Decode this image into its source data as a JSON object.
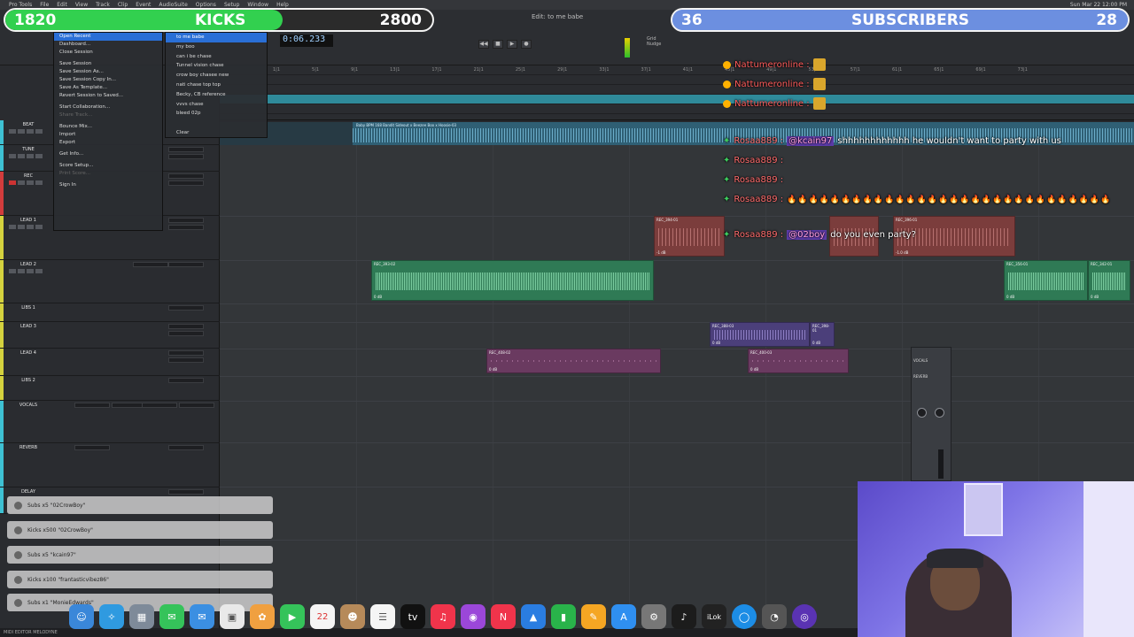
{
  "menubar": {
    "items": [
      "Pro Tools",
      "File",
      "Edit",
      "View",
      "Track",
      "Clip",
      "Event",
      "AudioSuite",
      "Options",
      "Setup",
      "Window",
      "Help"
    ],
    "clock": "Sun Mar 22  12:00 PM"
  },
  "session": {
    "edit_title": "Edit: to me babe",
    "counter": "0:06.233"
  },
  "overlays": {
    "kicks": {
      "current": "1820",
      "label": "KICKS",
      "goal": "2800",
      "progress": 0.65,
      "color": "#32d04f"
    },
    "subscribers": {
      "current": "36",
      "label": "SUBSCRIBERS",
      "goal": "28",
      "progress": 1.0,
      "color": "#6c8fe0"
    }
  },
  "file_menu": {
    "items": [
      {
        "label": "Open Recent",
        "state": "highlight"
      },
      {
        "label": "Dashboard...",
        "state": "normal"
      },
      {
        "label": "Close Session",
        "state": "normal"
      },
      {
        "label": "",
        "state": "sep"
      },
      {
        "label": "Save Session",
        "state": "normal"
      },
      {
        "label": "Save Session As...",
        "state": "normal"
      },
      {
        "label": "Save Session Copy In...",
        "state": "normal"
      },
      {
        "label": "Save As Template...",
        "state": "normal"
      },
      {
        "label": "Revert Session to Saved...",
        "state": "normal"
      },
      {
        "label": "",
        "state": "sep"
      },
      {
        "label": "Start Collaboration...",
        "state": "normal"
      },
      {
        "label": "Share Track...",
        "state": "dim"
      },
      {
        "label": "",
        "state": "sep"
      },
      {
        "label": "Bounce Mix...",
        "state": "normal"
      },
      {
        "label": "Import",
        "state": "normal"
      },
      {
        "label": "Export",
        "state": "normal"
      },
      {
        "label": "",
        "state": "sep"
      },
      {
        "label": "Get Info...",
        "state": "normal"
      },
      {
        "label": "",
        "state": "sep"
      },
      {
        "label": "Score Setup...",
        "state": "normal"
      },
      {
        "label": "Print Score...",
        "state": "dim"
      },
      {
        "label": "",
        "state": "sep"
      },
      {
        "label": "Sign In",
        "state": "normal"
      }
    ]
  },
  "recent_menu": {
    "items": [
      "to me babe",
      "my boo",
      "can i be chase",
      "Tunnel vision chase",
      "crow boy chasee new",
      "nati chase top top",
      "Becky, CB reference",
      "vvvs chase",
      "bleed 02p",
      "",
      "Clear"
    ]
  },
  "tracks": [
    {
      "name": "BEAT",
      "color": "#3ec1d3"
    },
    {
      "name": "TUNE",
      "color": "#3ec1d3"
    },
    {
      "name": "REC",
      "color": "#d23c3c"
    },
    {
      "name": "LEAD 1",
      "color": "#d4d23e"
    },
    {
      "name": "LEAD 2",
      "color": "#d4d23e"
    },
    {
      "name": "LIBS 1",
      "color": "#d4d23e"
    },
    {
      "name": "LEAD 3",
      "color": "#d4d23e"
    },
    {
      "name": "LEAD 4",
      "color": "#d4d23e"
    },
    {
      "name": "LIBS 2",
      "color": "#d4d23e"
    },
    {
      "name": "VOCALS",
      "color": "#3ec1d3"
    },
    {
      "name": "REVERB",
      "color": "#3ec1d3"
    },
    {
      "name": "DELAY",
      "color": "#3ec1d3"
    }
  ],
  "beat_clip_label": "Baby BPM 168 Bandit Sideout x Beezee Boo x Hoosie-03",
  "clips": [
    {
      "name": "REC_394-01",
      "db": "-1 dB",
      "color": "red"
    },
    {
      "name": "REC_396-01",
      "db": "-1.0 dB",
      "color": "red"
    },
    {
      "name": "REC_393-02",
      "db": "0 dB",
      "color": "green"
    },
    {
      "name": "REC_356-01",
      "db": "0 dB",
      "color": "green"
    },
    {
      "name": "REC_342-01",
      "db": "0 dB",
      "color": "green"
    },
    {
      "name": "REC_388-03",
      "db": "0 dB",
      "color": "violet"
    },
    {
      "name": "REC_398-01",
      "db": "0 dB",
      "color": "violet"
    },
    {
      "name": "REC_408-02",
      "db": "0 dB",
      "color": "purple"
    },
    {
      "name": "REC_400-03",
      "db": "0 dB",
      "color": "purple"
    }
  ],
  "chat": {
    "messages": [
      {
        "user": "Nattumeronline :",
        "text": "",
        "mention": ""
      },
      {
        "user": "Nattumeronline :",
        "text": "",
        "mention": ""
      },
      {
        "user": "Nattumeronline :",
        "text": "",
        "mention": ""
      },
      {
        "user": "Rosaa889 :",
        "mention": "@kcain97",
        "text": "shhhhhhhhhhhh he wouldn't want to party with us"
      },
      {
        "user": "Rosaa889 :",
        "text": "",
        "mention": ""
      },
      {
        "user": "Rosaa889 :",
        "text": "",
        "mention": ""
      },
      {
        "user": "Rosaa889 :",
        "text": "🔥🔥🔥🔥🔥🔥🔥🔥🔥🔥🔥🔥🔥🔥🔥🔥🔥🔥🔥🔥🔥🔥🔥🔥🔥🔥🔥🔥🔥🔥",
        "mention": ""
      },
      {
        "user": "Rosaa889 :",
        "mention": "@02boy",
        "text": "do you even party?"
      }
    ]
  },
  "alerts": [
    "Subs x5 \"02CrowBoy\"",
    "Kicks x500 \"02CrowBoy\"",
    "Subs x5 \"kcain97\"",
    "Kicks x100 \"frantasticvibez86\"",
    "Subs x1 \"MonieEdwards\""
  ],
  "dock": {
    "apps": [
      "Finder",
      "Safari",
      "Launchpad",
      "Messages",
      "Mail",
      "Preview",
      "Photos",
      "FaceTime",
      "Calendar",
      "Contacts",
      "Reminders",
      "Apple TV",
      "Music",
      "Podcasts",
      "News",
      "Keynote",
      "Numbers",
      "Pages",
      "App Store",
      "System Settings",
      "Logic",
      "iLok",
      "Pro Tools",
      "Activity",
      "OBS"
    ],
    "calendar_day": "22"
  },
  "status_text": "MIDI EDITOR   MELODYNE"
}
